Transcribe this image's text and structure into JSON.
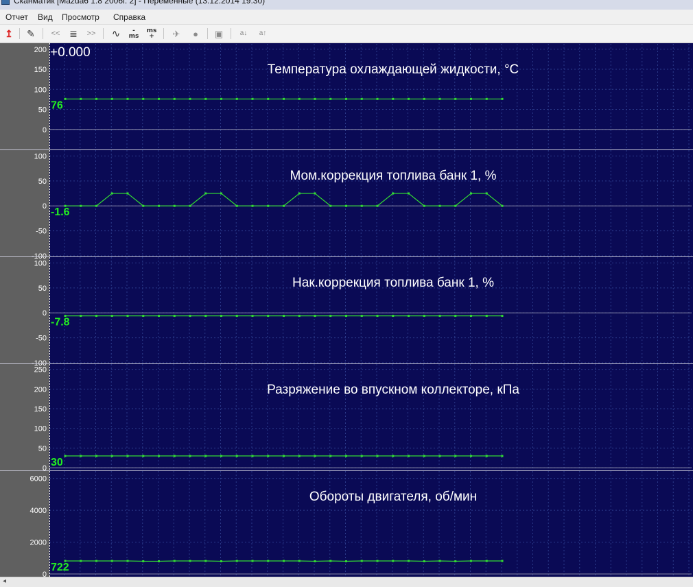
{
  "window": {
    "title": "Сканматик [Mazda6 1.8 2006г. 2] - Переменные (13.12.2014 19:30)"
  },
  "menu": {
    "items": [
      "Отчет",
      "Вид",
      "Просмотр",
      "Справка"
    ]
  },
  "toolbar": {
    "buttons": [
      {
        "name": "exit-icon",
        "glyph": "↥"
      },
      {
        "name": "edit-icon",
        "glyph": "✎"
      },
      {
        "name": "prev-icon",
        "glyph": "<<"
      },
      {
        "name": "list-icon",
        "glyph": "≣"
      },
      {
        "name": "next-icon",
        "glyph": ">>"
      },
      {
        "name": "wave-icon",
        "glyph": "∿"
      },
      {
        "name": "ms-minus-icon",
        "glyph": "ms"
      },
      {
        "name": "ms-plus-icon",
        "glyph": "ms"
      },
      {
        "name": "airplane-icon",
        "glyph": "✈"
      },
      {
        "name": "record-icon",
        "glyph": "●"
      },
      {
        "name": "image-icon",
        "glyph": "▣"
      },
      {
        "name": "font-decrease-icon",
        "glyph": "a↓"
      },
      {
        "name": "font-increase-icon",
        "glyph": "a↑"
      }
    ]
  },
  "cursor_time": "+0.000",
  "colors": {
    "plot_bg": "#0a0a55",
    "axis_strip": "#606060",
    "trace": "#33dd33",
    "value_label": "#22ee22",
    "title_text": "#ffffff",
    "grid": "#2b3a8a"
  },
  "chart_data": [
    {
      "type": "line",
      "title": "Температура охлаждающей жидкости, °С",
      "current_value": "76",
      "y_ticks": [
        200,
        150,
        100,
        50,
        0
      ],
      "ylim": [
        -50,
        215
      ],
      "values": [
        76,
        76,
        76,
        76,
        76,
        76,
        76,
        76,
        76,
        76,
        76,
        76,
        76,
        76,
        76,
        76,
        76,
        76,
        76,
        76,
        76,
        76,
        76,
        76,
        76,
        76,
        76,
        76,
        76
      ]
    },
    {
      "type": "line",
      "title": "Мом.коррекция топлива банк 1, %",
      "current_value": "-1.6",
      "y_ticks": [
        100,
        50,
        0,
        -50,
        -100
      ],
      "ylim": [
        -100,
        113
      ],
      "values": [
        0,
        0,
        0,
        25,
        25,
        0,
        0,
        0,
        0,
        25,
        25,
        0,
        0,
        0,
        0,
        25,
        25,
        0,
        0,
        0,
        0,
        25,
        25,
        0,
        0,
        0,
        25,
        25,
        0
      ]
    },
    {
      "type": "line",
      "title": "Нак.коррекция топлива банк 1, %",
      "current_value": "-7.8",
      "y_ticks": [
        100,
        50,
        0,
        -50,
        -100
      ],
      "ylim": [
        -100,
        113
      ],
      "values": [
        -6,
        -6,
        -6,
        -6,
        -6,
        -6,
        -6,
        -6,
        -6,
        -6,
        -6,
        -6,
        -6,
        -6,
        -6,
        -6,
        -6,
        -6,
        -6,
        -6,
        -6,
        -6,
        -6,
        -6,
        -6,
        -6,
        -6,
        -6,
        -6
      ]
    },
    {
      "type": "line",
      "title": "Разряжение во впускном коллекторе, кПа",
      "current_value": "30",
      "y_ticks": [
        250,
        200,
        150,
        100,
        50,
        0
      ],
      "ylim": [
        -5,
        265
      ],
      "values": [
        30,
        30,
        30,
        30,
        30,
        30,
        30,
        30,
        30,
        30,
        30,
        30,
        30,
        30,
        30,
        30,
        30,
        30,
        30,
        30,
        30,
        30,
        30,
        30,
        30,
        30,
        30,
        30,
        30
      ]
    },
    {
      "type": "line",
      "title": "Обороты двигателя, об/мин",
      "current_value": "722",
      "y_ticks": [
        6000,
        4000,
        2000,
        0
      ],
      "ylim": [
        -170,
        6500
      ],
      "values": [
        820,
        820,
        820,
        820,
        820,
        800,
        800,
        820,
        820,
        820,
        800,
        820,
        820,
        820,
        820,
        820,
        800,
        820,
        800,
        820,
        820,
        820,
        820,
        800,
        820,
        800,
        820,
        820,
        820
      ]
    }
  ]
}
